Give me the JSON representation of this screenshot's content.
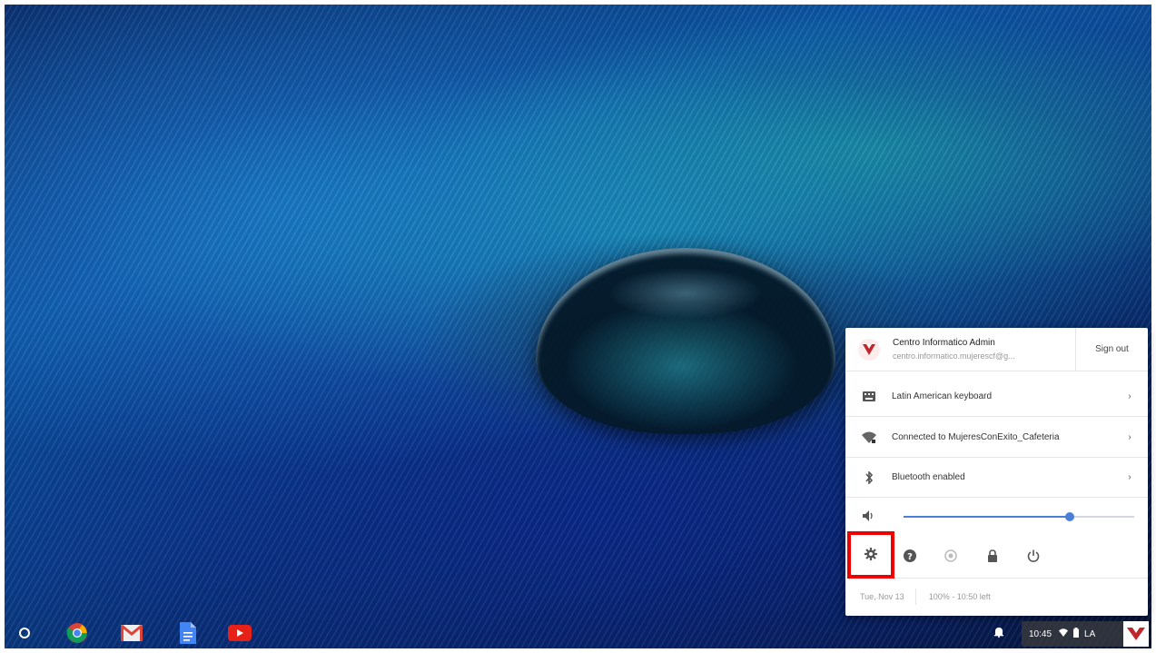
{
  "tray": {
    "user_name": "Centro Informatico Admin",
    "user_email": "centro.informatico.mujerescf@g...",
    "signout_label": "Sign out",
    "keyboard_label": "Latin American keyboard",
    "network_label": "Connected to MujeresConExito_Cafeteria",
    "bluetooth_label": "Bluetooth enabled",
    "volume_level": 0.72,
    "date_label": "Tue, Nov 13",
    "battery_label": "100% - 10:50 left"
  },
  "shelf": {
    "clock": "10:45",
    "input_method": "LA"
  },
  "colors": {
    "accent": "#4a7fd8",
    "highlight": "#e00000",
    "avatar": "#c0272d"
  },
  "icons": [
    "settings-icon",
    "help-icon",
    "cast-icon",
    "lock-icon",
    "power-icon",
    "volume-icon",
    "keyboard-icon",
    "wifi-icon",
    "bluetooth-icon"
  ]
}
